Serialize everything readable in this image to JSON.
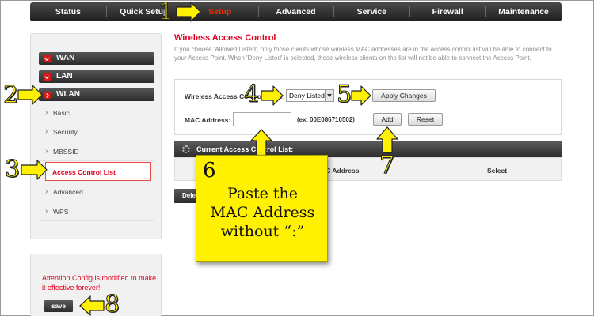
{
  "nav": {
    "items": [
      "Status",
      "Quick Setup",
      "Setup",
      "Advanced",
      "Service",
      "Firewall",
      "Maintenance"
    ],
    "active": "Setup"
  },
  "sidebar": {
    "groups": [
      "WAN",
      "LAN",
      "WLAN"
    ],
    "wlan_items": [
      "Basic",
      "Security",
      "MBSSID",
      "Access Control List",
      "Advanced",
      "WPS"
    ],
    "active": "Access Control List"
  },
  "attention": {
    "text": "Attention Config is modified to make it effective forever!",
    "save_label": "save"
  },
  "main": {
    "title": "Wireless Access Control",
    "description": "If you choose 'Allowed Listed', only those clients whose wireless MAC addresses are in the access control list will be able to connect to your Access Point. When 'Deny Listed' is selected, these wireless clients on the list will not be able to connect the Access Point.",
    "mode_label": "Wireless Access Control Mode:",
    "mode_value": "Deny Listed",
    "apply_label": "Apply Changes",
    "mac_label": "MAC Address:",
    "mac_value": "",
    "mac_example": "(ex. 00E086710502)",
    "add_label": "Add",
    "reset_label": "Reset",
    "list_title": "Current Access Control List:",
    "col_mac": "MAC Address",
    "col_select": "Select",
    "delete_label": "Delete Selected"
  },
  "annotations": {
    "numbers": [
      "1",
      "2",
      "3",
      "4",
      "5",
      "6",
      "7",
      "8"
    ],
    "callout": "Paste the\nMAC Address\nwithout “:”",
    "color": "#fff100"
  }
}
